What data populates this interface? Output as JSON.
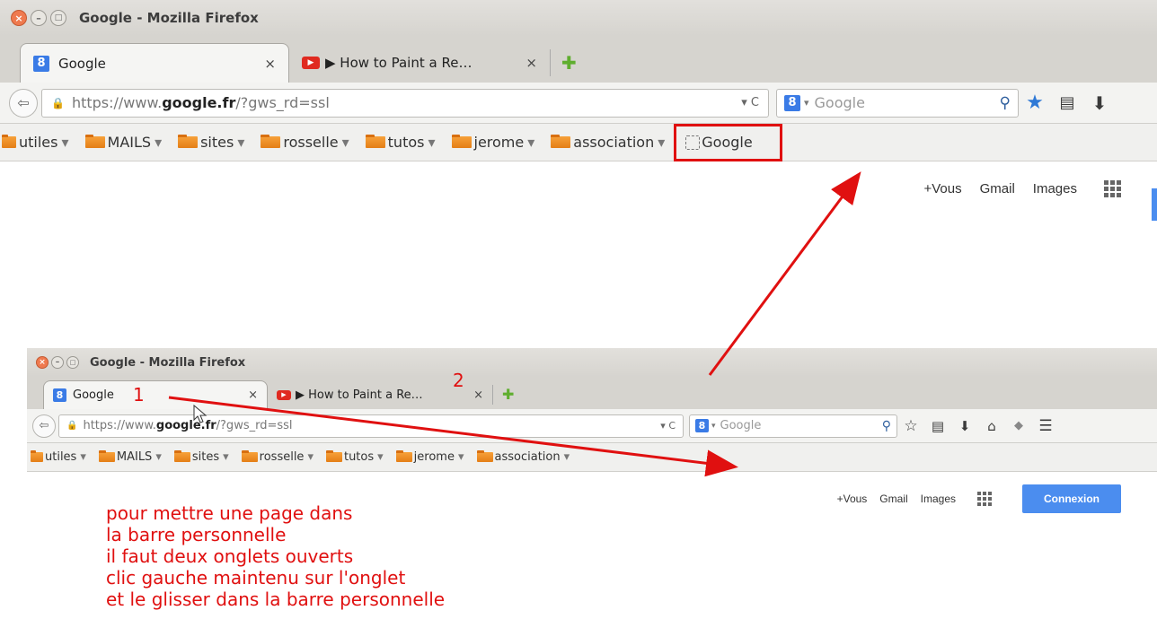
{
  "top_window": {
    "title": "Google - Mozilla Firefox",
    "tabs": [
      {
        "label": "Google",
        "favicon": "8",
        "close": "×"
      },
      {
        "label": "▶ How to Paint a Re…",
        "close": "×"
      }
    ],
    "new_tab": "✚",
    "url": {
      "prefix": "https://www.",
      "domain": "google.fr",
      "suffix": "/?gws_rd=ssl"
    },
    "url_dropdown": "▾ C",
    "search_engine": "8",
    "search_placeholder": "Google",
    "bookmarks": [
      {
        "label": "utiles"
      },
      {
        "label": "MAILS"
      },
      {
        "label": "sites"
      },
      {
        "label": "rosselle"
      },
      {
        "label": "tutos"
      },
      {
        "label": "jerome"
      },
      {
        "label": "association"
      }
    ],
    "bookmark_new": "Google",
    "page_links": [
      "+Vous",
      "Gmail",
      "Images"
    ]
  },
  "bottom_window": {
    "title": "Google - Mozilla Firefox",
    "tabs": [
      {
        "label": "Google",
        "favicon": "8",
        "close": "×"
      },
      {
        "label": "▶ How to Paint a Re…",
        "close": "×"
      }
    ],
    "new_tab": "✚",
    "url": {
      "prefix": "https://www.",
      "domain": "google.fr",
      "suffix": "/?gws_rd=ssl"
    },
    "url_dropdown": "▾ C",
    "search_engine": "8",
    "search_placeholder": "Google",
    "bookmarks": [
      {
        "label": "utiles"
      },
      {
        "label": "MAILS"
      },
      {
        "label": "sites"
      },
      {
        "label": "rosselle"
      },
      {
        "label": "tutos"
      },
      {
        "label": "jerome"
      },
      {
        "label": "association"
      }
    ],
    "page_links": [
      "+Vous",
      "Gmail",
      "Images"
    ],
    "connect": "Connexion"
  },
  "annotations": {
    "num1": "1",
    "num2": "2",
    "lines": [
      "pour mettre une page dans",
      "la barre personnelle",
      "il faut deux onglets ouverts",
      "clic gauche maintenu sur l'onglet",
      "et le glisser dans la barre personnelle"
    ],
    "color": "#e01010"
  },
  "icons": [
    "close-icon",
    "minimize-icon",
    "maximize-icon",
    "back-icon",
    "lock-icon",
    "search-icon",
    "star-icon",
    "reading-list-icon",
    "download-icon",
    "home-icon",
    "pocket-icon",
    "menu-icon",
    "apps-grid-icon",
    "folder-icon",
    "cursor-icon"
  ]
}
